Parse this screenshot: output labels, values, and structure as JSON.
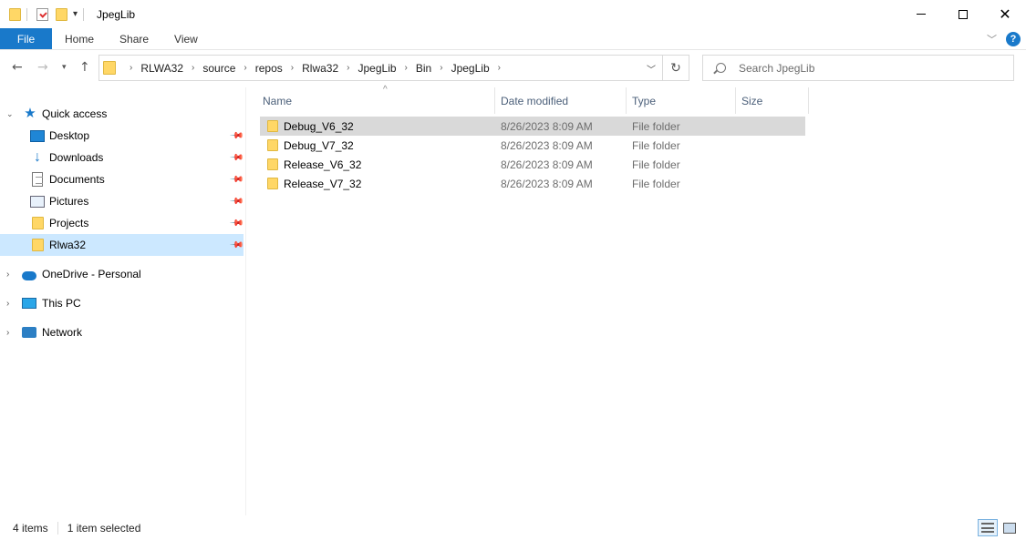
{
  "window": {
    "title": "JpegLib",
    "controls": {
      "minimize": "—",
      "maximize": "☐",
      "close": "✕"
    }
  },
  "ribbon": {
    "tabs": [
      {
        "label": "File"
      },
      {
        "label": "Home"
      },
      {
        "label": "Share"
      },
      {
        "label": "View"
      }
    ],
    "help": "?"
  },
  "address": {
    "crumbs": [
      "RLWA32",
      "source",
      "repos",
      "Rlwa32",
      "JpegLib",
      "Bin",
      "JpegLib"
    ]
  },
  "search": {
    "placeholder": "Search JpegLib"
  },
  "nav": {
    "quick_access": "Quick access",
    "items": [
      {
        "label": "Desktop",
        "icon": "desktop-icon"
      },
      {
        "label": "Downloads",
        "icon": "download-icon"
      },
      {
        "label": "Documents",
        "icon": "documents-icon"
      },
      {
        "label": "Pictures",
        "icon": "pictures-icon"
      },
      {
        "label": "Projects",
        "icon": "folder-icon"
      },
      {
        "label": "Rlwa32",
        "icon": "folder-icon"
      }
    ],
    "onedrive": "OneDrive - Personal",
    "this_pc": "This PC",
    "network": "Network"
  },
  "columns": {
    "name": "Name",
    "date": "Date modified",
    "type": "Type",
    "size": "Size"
  },
  "files": [
    {
      "name": "Debug_V6_32",
      "date": "8/26/2023 8:09 AM",
      "type": "File folder"
    },
    {
      "name": "Debug_V7_32",
      "date": "8/26/2023 8:09 AM",
      "type": "File folder"
    },
    {
      "name": "Release_V6_32",
      "date": "8/26/2023 8:09 AM",
      "type": "File folder"
    },
    {
      "name": "Release_V7_32",
      "date": "8/26/2023 8:09 AM",
      "type": "File folder"
    }
  ],
  "status": {
    "count": "4 items",
    "selected": "1 item selected"
  },
  "colors": {
    "accent": "#1979ca",
    "selection": "#cce8ff",
    "row_selected": "#d9d9d9",
    "folder": "#ffd766"
  }
}
